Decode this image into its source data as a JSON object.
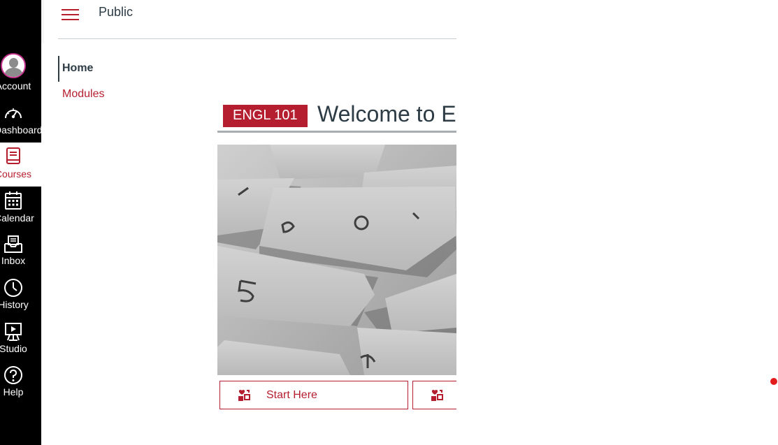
{
  "global_nav": {
    "items": [
      {
        "label": "Account",
        "icon": "avatar"
      },
      {
        "label": "Dashboard",
        "icon": "speedometer-icon"
      },
      {
        "label": "Courses",
        "icon": "book-icon"
      },
      {
        "label": "Calendar",
        "icon": "calendar-icon"
      },
      {
        "label": "Inbox",
        "icon": "inbox-icon"
      },
      {
        "label": "History",
        "icon": "clock-icon"
      },
      {
        "label": "Studio",
        "icon": "studio-icon"
      },
      {
        "label": "Help",
        "icon": "question-icon"
      }
    ],
    "active": "Courses"
  },
  "header": {
    "breadcrumb": "Public"
  },
  "course_nav": {
    "items": [
      {
        "label": "Home",
        "active": true
      },
      {
        "label": "Modules",
        "active": false
      }
    ]
  },
  "content": {
    "course_code": "ENGL 101",
    "heading": "Welcome to E",
    "tiles": [
      {
        "label": "Start Here",
        "icon": "puzzle-hearts-icon"
      },
      {
        "label": "",
        "icon": "puzzle-hearts-icon"
      }
    ]
  },
  "colors": {
    "brand": "#b51e2e",
    "nav_bg": "#000000",
    "text": "#2d3b45",
    "avatar_ring": "#c5338e",
    "notification_dot": "#e21b1b"
  }
}
